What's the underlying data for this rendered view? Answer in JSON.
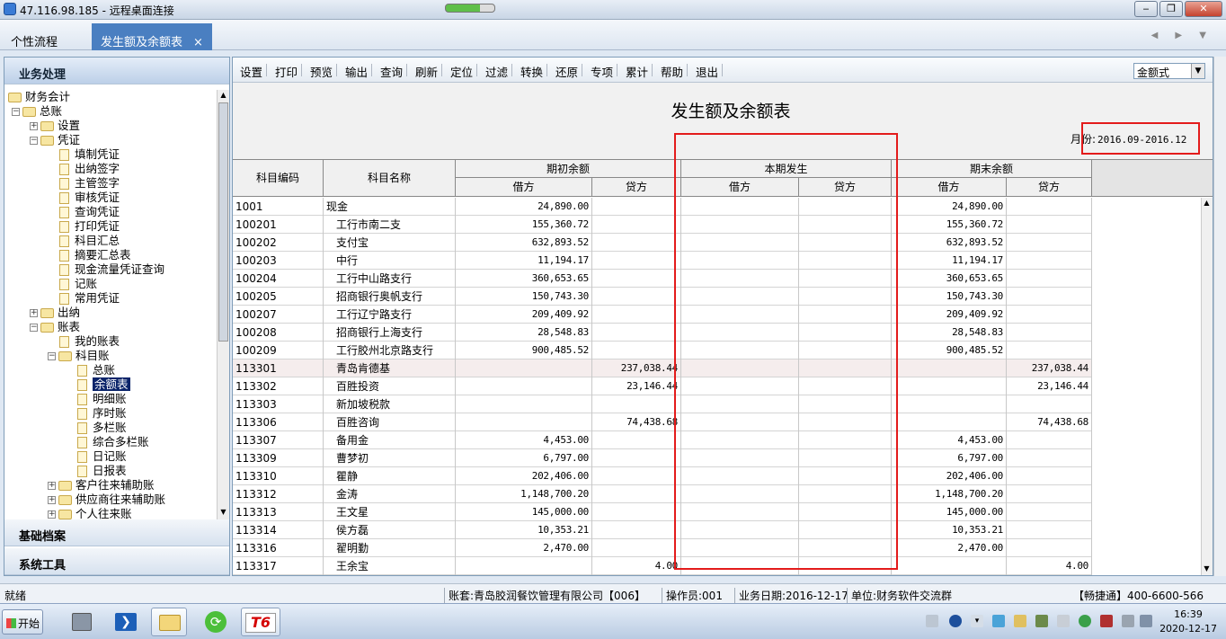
{
  "window": {
    "title": "47.116.98.185 - 远程桌面连接"
  },
  "tabs": [
    {
      "label": "个性流程"
    },
    {
      "label": "发生额及余额表",
      "close": "×"
    }
  ],
  "sidebar": {
    "header": "业务处理",
    "tree": [
      {
        "label": "财务会计",
        "level": 0,
        "exp": "",
        "icon": "folder"
      },
      {
        "label": "总账",
        "level": 1,
        "exp": "−",
        "icon": "folder"
      },
      {
        "label": "设置",
        "level": 2,
        "exp": "+",
        "icon": "folder"
      },
      {
        "label": "凭证",
        "level": 2,
        "exp": "−",
        "icon": "folder"
      },
      {
        "label": "填制凭证",
        "level": 3,
        "icon": "doc"
      },
      {
        "label": "出纳签字",
        "level": 3,
        "icon": "doc"
      },
      {
        "label": "主管签字",
        "level": 3,
        "icon": "doc"
      },
      {
        "label": "审核凭证",
        "level": 3,
        "icon": "doc"
      },
      {
        "label": "查询凭证",
        "level": 3,
        "icon": "doc"
      },
      {
        "label": "打印凭证",
        "level": 3,
        "icon": "doc"
      },
      {
        "label": "科目汇总",
        "level": 3,
        "icon": "doc"
      },
      {
        "label": "摘要汇总表",
        "level": 3,
        "icon": "doc"
      },
      {
        "label": "现金流量凭证查询",
        "level": 3,
        "icon": "doc"
      },
      {
        "label": "记账",
        "level": 3,
        "icon": "doc"
      },
      {
        "label": "常用凭证",
        "level": 3,
        "icon": "doc"
      },
      {
        "label": "出纳",
        "level": 2,
        "exp": "+",
        "icon": "folder"
      },
      {
        "label": "账表",
        "level": 2,
        "exp": "−",
        "icon": "folder"
      },
      {
        "label": "我的账表",
        "level": 3,
        "icon": "doc"
      },
      {
        "label": "科目账",
        "level": 3,
        "exp": "−",
        "icon": "folder"
      },
      {
        "label": "总账",
        "level": 4,
        "icon": "doc"
      },
      {
        "label": "余额表",
        "level": 4,
        "icon": "doc",
        "selected": true
      },
      {
        "label": "明细账",
        "level": 4,
        "icon": "doc"
      },
      {
        "label": "序时账",
        "level": 4,
        "icon": "doc"
      },
      {
        "label": "多栏账",
        "level": 4,
        "icon": "doc"
      },
      {
        "label": "综合多栏账",
        "level": 4,
        "icon": "doc"
      },
      {
        "label": "日记账",
        "level": 4,
        "icon": "doc"
      },
      {
        "label": "日报表",
        "level": 4,
        "icon": "doc"
      },
      {
        "label": "客户往来辅助账",
        "level": 3,
        "exp": "+",
        "icon": "folder"
      },
      {
        "label": "供应商往来辅助账",
        "level": 3,
        "exp": "+",
        "icon": "folder"
      },
      {
        "label": "个人往来账",
        "level": 3,
        "exp": "+",
        "icon": "folder"
      }
    ],
    "sections": [
      "基础档案",
      "系统工具"
    ]
  },
  "toolbar": {
    "buttons": [
      "设置",
      "打印",
      "预览",
      "输出",
      "查询",
      "刷新",
      "定位",
      "过滤",
      "转换",
      "还原",
      "专项",
      "累计",
      "帮助",
      "退出"
    ],
    "mode_select": "金额式"
  },
  "report": {
    "title": "发生额及余额表",
    "month_label": "月份:",
    "month_value": "2016.09-2016.12",
    "headers": {
      "code": "科目编码",
      "name": "科目名称",
      "opening": "期初余额",
      "current": "本期发生",
      "closing": "期末余额",
      "debit": "借方",
      "credit": "贷方"
    },
    "rows": [
      {
        "code": "1001",
        "name": "现金",
        "od": "24,890.00",
        "oc": "",
        "cd": "",
        "cc": "",
        "ed": "24,890.00",
        "ec": "",
        "indent": 0
      },
      {
        "code": "100201",
        "name": "工行市南二支",
        "od": "155,360.72",
        "oc": "",
        "cd": "",
        "cc": "",
        "ed": "155,360.72",
        "ec": "",
        "indent": 1
      },
      {
        "code": "100202",
        "name": "支付宝",
        "od": "632,893.52",
        "oc": "",
        "cd": "",
        "cc": "",
        "ed": "632,893.52",
        "ec": "",
        "indent": 1
      },
      {
        "code": "100203",
        "name": "中行",
        "od": "11,194.17",
        "oc": "",
        "cd": "",
        "cc": "",
        "ed": "11,194.17",
        "ec": "",
        "indent": 1
      },
      {
        "code": "100204",
        "name": "工行中山路支行",
        "od": "360,653.65",
        "oc": "",
        "cd": "",
        "cc": "",
        "ed": "360,653.65",
        "ec": "",
        "indent": 1
      },
      {
        "code": "100205",
        "name": "招商银行奥帆支行",
        "od": "150,743.30",
        "oc": "",
        "cd": "",
        "cc": "",
        "ed": "150,743.30",
        "ec": "",
        "indent": 1
      },
      {
        "code": "100207",
        "name": "工行辽宁路支行",
        "od": "209,409.92",
        "oc": "",
        "cd": "",
        "cc": "",
        "ed": "209,409.92",
        "ec": "",
        "indent": 1
      },
      {
        "code": "100208",
        "name": "招商银行上海支行",
        "od": "28,548.83",
        "oc": "",
        "cd": "",
        "cc": "",
        "ed": "28,548.83",
        "ec": "",
        "indent": 1
      },
      {
        "code": "100209",
        "name": "工行胶州北京路支行",
        "od": "900,485.52",
        "oc": "",
        "cd": "",
        "cc": "",
        "ed": "900,485.52",
        "ec": "",
        "indent": 1
      },
      {
        "code": "113301",
        "name": "青岛肯德基",
        "od": "",
        "oc": "237,038.44",
        "cd": "",
        "cc": "",
        "ed": "",
        "ec": "237,038.44",
        "indent": 1,
        "hl": true
      },
      {
        "code": "113302",
        "name": "百胜投资",
        "od": "",
        "oc": "23,146.44",
        "cd": "",
        "cc": "",
        "ed": "",
        "ec": "23,146.44",
        "indent": 1
      },
      {
        "code": "113303",
        "name": "新加坡税款",
        "od": "",
        "oc": "",
        "cd": "",
        "cc": "",
        "ed": "",
        "ec": "",
        "indent": 1
      },
      {
        "code": "113306",
        "name": "百胜咨询",
        "od": "",
        "oc": "74,438.68",
        "cd": "",
        "cc": "",
        "ed": "",
        "ec": "74,438.68",
        "indent": 1
      },
      {
        "code": "113307",
        "name": "备用金",
        "od": "4,453.00",
        "oc": "",
        "cd": "",
        "cc": "",
        "ed": "4,453.00",
        "ec": "",
        "indent": 1
      },
      {
        "code": "113309",
        "name": "曹梦初",
        "od": "6,797.00",
        "oc": "",
        "cd": "",
        "cc": "",
        "ed": "6,797.00",
        "ec": "",
        "indent": 1
      },
      {
        "code": "113310",
        "name": "瞿静",
        "od": "202,406.00",
        "oc": "",
        "cd": "",
        "cc": "",
        "ed": "202,406.00",
        "ec": "",
        "indent": 1
      },
      {
        "code": "113312",
        "name": "金涛",
        "od": "1,148,700.20",
        "oc": "",
        "cd": "",
        "cc": "",
        "ed": "1,148,700.20",
        "ec": "",
        "indent": 1
      },
      {
        "code": "113313",
        "name": "王文星",
        "od": "145,000.00",
        "oc": "",
        "cd": "",
        "cc": "",
        "ed": "145,000.00",
        "ec": "",
        "indent": 1
      },
      {
        "code": "113314",
        "name": "侯方磊",
        "od": "10,353.21",
        "oc": "",
        "cd": "",
        "cc": "",
        "ed": "10,353.21",
        "ec": "",
        "indent": 1
      },
      {
        "code": "113316",
        "name": "翟明勤",
        "od": "2,470.00",
        "oc": "",
        "cd": "",
        "cc": "",
        "ed": "2,470.00",
        "ec": "",
        "indent": 1
      },
      {
        "code": "113317",
        "name": "王余宝",
        "od": "",
        "oc": "4.00",
        "cd": "",
        "cc": "",
        "ed": "",
        "ec": "4.00",
        "indent": 1
      }
    ]
  },
  "status": {
    "ready": "就绪",
    "account": "账套:青岛胶润餐饮管理有限公司【006】",
    "operator": "操作员:001",
    "bizdate": "业务日期:2016-12-17",
    "unit": "单位:财务软件交流群",
    "hotline": "【畅捷通】400-6600-566"
  },
  "taskbar": {
    "start": "开始",
    "t6": "T6",
    "time": "16:39",
    "date": "2020-12-17"
  },
  "colors": {
    "highlight": "#e31b1b",
    "tab_active": "#4a7fc1",
    "selection": "#0a246a"
  }
}
